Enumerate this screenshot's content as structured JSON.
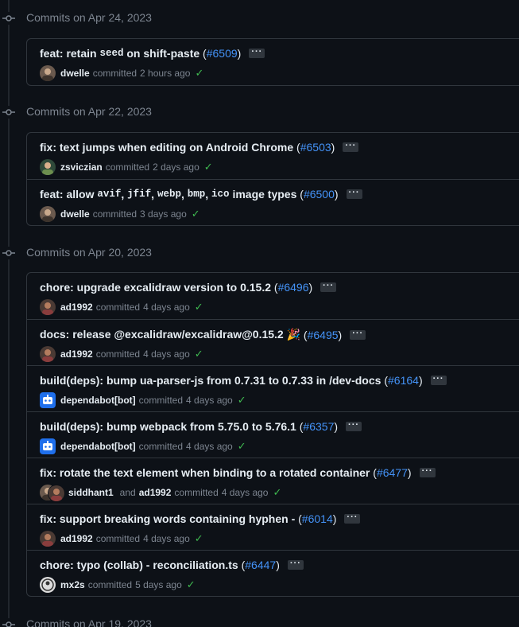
{
  "groups": [
    {
      "title": "Commits on Apr 24, 2023",
      "commits": [
        {
          "parts": [
            {
              "t": "text",
              "v": "feat: retain "
            },
            {
              "t": "code",
              "v": "seed"
            },
            {
              "t": "text",
              "v": " on shift-paste "
            }
          ],
          "pr": "#6509",
          "authors": [
            "dwelle"
          ],
          "committed": "committed",
          "time": "2 hours ago",
          "avatar": "dwelle"
        }
      ]
    },
    {
      "title": "Commits on Apr 22, 2023",
      "commits": [
        {
          "parts": [
            {
              "t": "text",
              "v": "fix: text jumps when editing on Android Chrome "
            }
          ],
          "pr": "#6503",
          "authors": [
            "zsviczian"
          ],
          "committed": "committed",
          "time": "2 days ago",
          "avatar": "zsviczian"
        },
        {
          "parts": [
            {
              "t": "text",
              "v": "feat: allow "
            },
            {
              "t": "code",
              "v": "avif"
            },
            {
              "t": "text",
              "v": ", "
            },
            {
              "t": "code",
              "v": "jfif"
            },
            {
              "t": "text",
              "v": ", "
            },
            {
              "t": "code",
              "v": "webp"
            },
            {
              "t": "text",
              "v": ", "
            },
            {
              "t": "code",
              "v": "bmp"
            },
            {
              "t": "text",
              "v": ", "
            },
            {
              "t": "code",
              "v": "ico"
            },
            {
              "t": "text",
              "v": " image types "
            }
          ],
          "pr": "#6500",
          "authors": [
            "dwelle"
          ],
          "committed": "committed",
          "time": "3 days ago",
          "avatar": "dwelle"
        }
      ]
    },
    {
      "title": "Commits on Apr 20, 2023",
      "commits": [
        {
          "parts": [
            {
              "t": "text",
              "v": "chore: upgrade excalidraw version to 0.15.2 "
            }
          ],
          "pr": "#6496",
          "authors": [
            "ad1992"
          ],
          "committed": "committed",
          "time": "4 days ago",
          "avatar": "ad1992"
        },
        {
          "parts": [
            {
              "t": "text",
              "v": "docs: release @excalidraw/excalidraw@0.15.2 🎉 "
            }
          ],
          "pr": "#6495",
          "authors": [
            "ad1992"
          ],
          "committed": "committed",
          "time": "4 days ago",
          "avatar": "ad1992"
        },
        {
          "parts": [
            {
              "t": "text",
              "v": "build(deps): bump ua-parser-js from 0.7.31 to 0.7.33 in /dev-docs "
            }
          ],
          "pr": "#6164",
          "authors": [
            "dependabot[bot]"
          ],
          "committed": "committed",
          "time": "4 days ago",
          "avatar": "bot"
        },
        {
          "parts": [
            {
              "t": "text",
              "v": "build(deps): bump webpack from 5.75.0 to 5.76.1 "
            }
          ],
          "pr": "#6357",
          "authors": [
            "dependabot[bot]"
          ],
          "committed": "committed",
          "time": "4 days ago",
          "avatar": "bot"
        },
        {
          "parts": [
            {
              "t": "text",
              "v": "fix: rotate the text element when binding to a rotated container "
            }
          ],
          "pr": "#6477",
          "authors": [
            "siddhant1",
            "ad1992"
          ],
          "and": "and",
          "committed": "committed",
          "time": "4 days ago",
          "avatar": "pair"
        },
        {
          "parts": [
            {
              "t": "text",
              "v": "fix: support breaking words containing hyphen - "
            }
          ],
          "pr": "#6014",
          "authors": [
            "ad1992"
          ],
          "committed": "committed",
          "time": "4 days ago",
          "avatar": "ad1992"
        },
        {
          "parts": [
            {
              "t": "text",
              "v": "chore: typo (collab) - reconciliation.ts "
            }
          ],
          "pr": "#6447",
          "authors": [
            "mx2s"
          ],
          "committed": "committed",
          "time": "5 days ago",
          "avatar": "mx2s"
        }
      ]
    },
    {
      "title": "Commits on Apr 19, 2023",
      "commits": []
    }
  ],
  "ellipsis": "···",
  "check_glyph": "✓",
  "colors": {
    "link": "#4493f8",
    "check": "#3fb950",
    "muted": "#7d8590",
    "text": "#e6edf3",
    "border": "#30363d"
  }
}
